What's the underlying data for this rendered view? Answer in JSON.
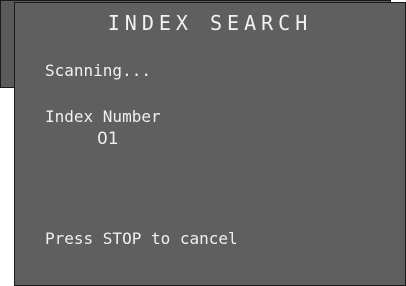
{
  "dialog": {
    "title": "INDEX SEARCH",
    "status_text": "Scanning...",
    "index_label": "Index Number",
    "index_value": "01",
    "footer_hint": "Press STOP to cancel"
  },
  "colors": {
    "panel_background": "#5f5f5f",
    "panel_border": "#1a1a1a",
    "text": "#f0f0f0"
  }
}
